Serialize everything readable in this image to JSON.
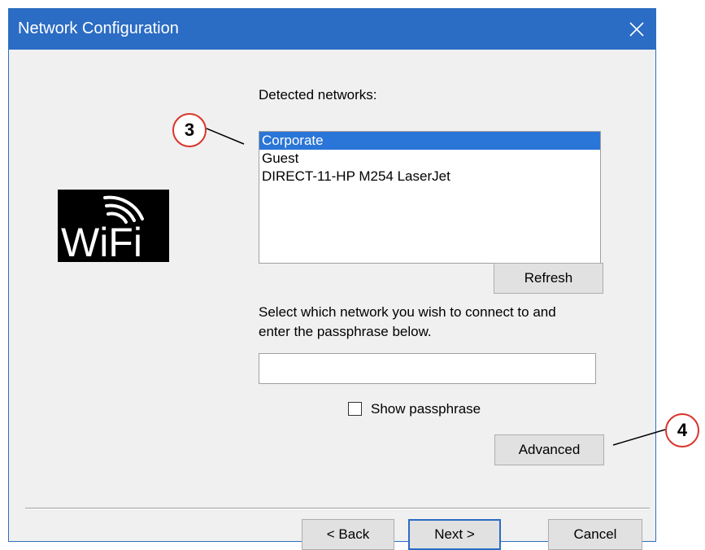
{
  "window": {
    "title": "Network Configuration"
  },
  "networks": {
    "label": "Detected networks:",
    "items": [
      "Corporate",
      "Guest",
      "DIRECT-11-HP M254 LaserJet"
    ],
    "selected_index": 0
  },
  "buttons": {
    "refresh": "Refresh",
    "advanced": "Advanced",
    "back": "< Back",
    "next": "Next >",
    "cancel": "Cancel"
  },
  "instructions": {
    "line1": "Select which network you wish to connect to and",
    "line2": "enter the passphrase below."
  },
  "passphrase": {
    "value": ""
  },
  "show_passphrase": {
    "label": "Show passphrase",
    "checked": false
  },
  "logo": {
    "text": "WiFi"
  },
  "callouts": [
    "3",
    "4"
  ],
  "colors": {
    "titlebar": "#2b6cc4",
    "selection": "#2a75d8",
    "callout_border": "#d9342b"
  }
}
